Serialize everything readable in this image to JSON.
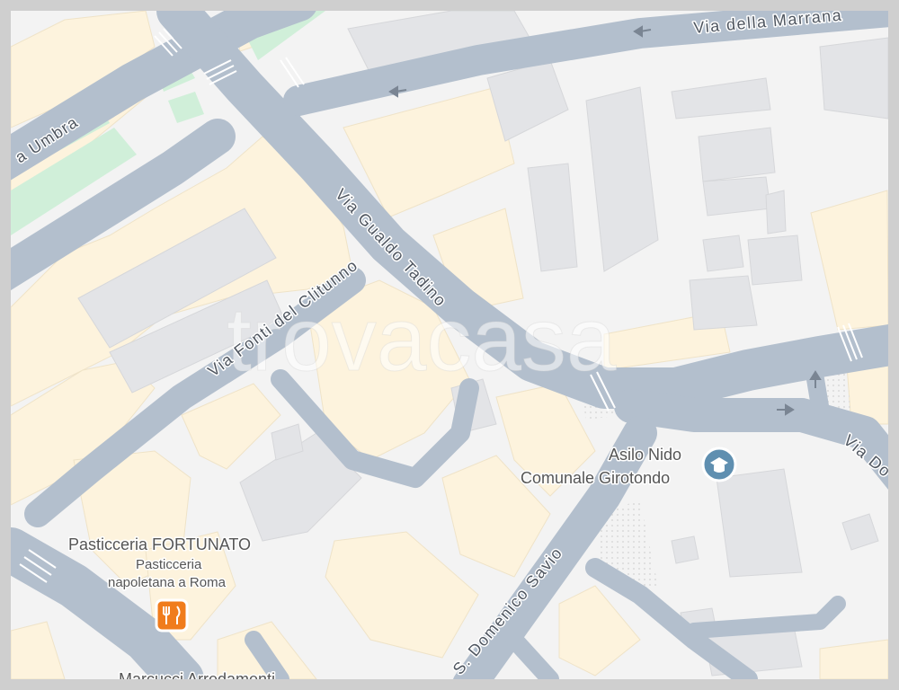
{
  "map": {
    "watermark": "trovacasa",
    "roads": {
      "via_umbra": "a Umbra",
      "via_della_marrana": "Via della Marrana",
      "via_gualdo_tadino": "Via Gualdo Tadino",
      "via_fonti_del_clitunno": "Via Fonti del Clitunno",
      "via_s_domenico_savio": "S. Domenico Savio",
      "via_do": "Via Do"
    },
    "pois": {
      "asilo": {
        "line1": "Asilo Nido",
        "line2": "Comunale Girotondo",
        "icon": "school-icon"
      },
      "pasticceria": {
        "title": "Pasticceria FORTUNATO",
        "sub1": "Pasticceria",
        "sub2": "napoletana a Roma",
        "icon": "restaurant-icon"
      },
      "marcucci": {
        "title": "Marcucci Arredamenti"
      }
    },
    "colors": {
      "road": "#b3bfcd",
      "building": "#fdf3dd",
      "gray_building": "#e3e4e7",
      "park": "#d0efd9",
      "restaurant_accent": "#f07c1c"
    }
  }
}
